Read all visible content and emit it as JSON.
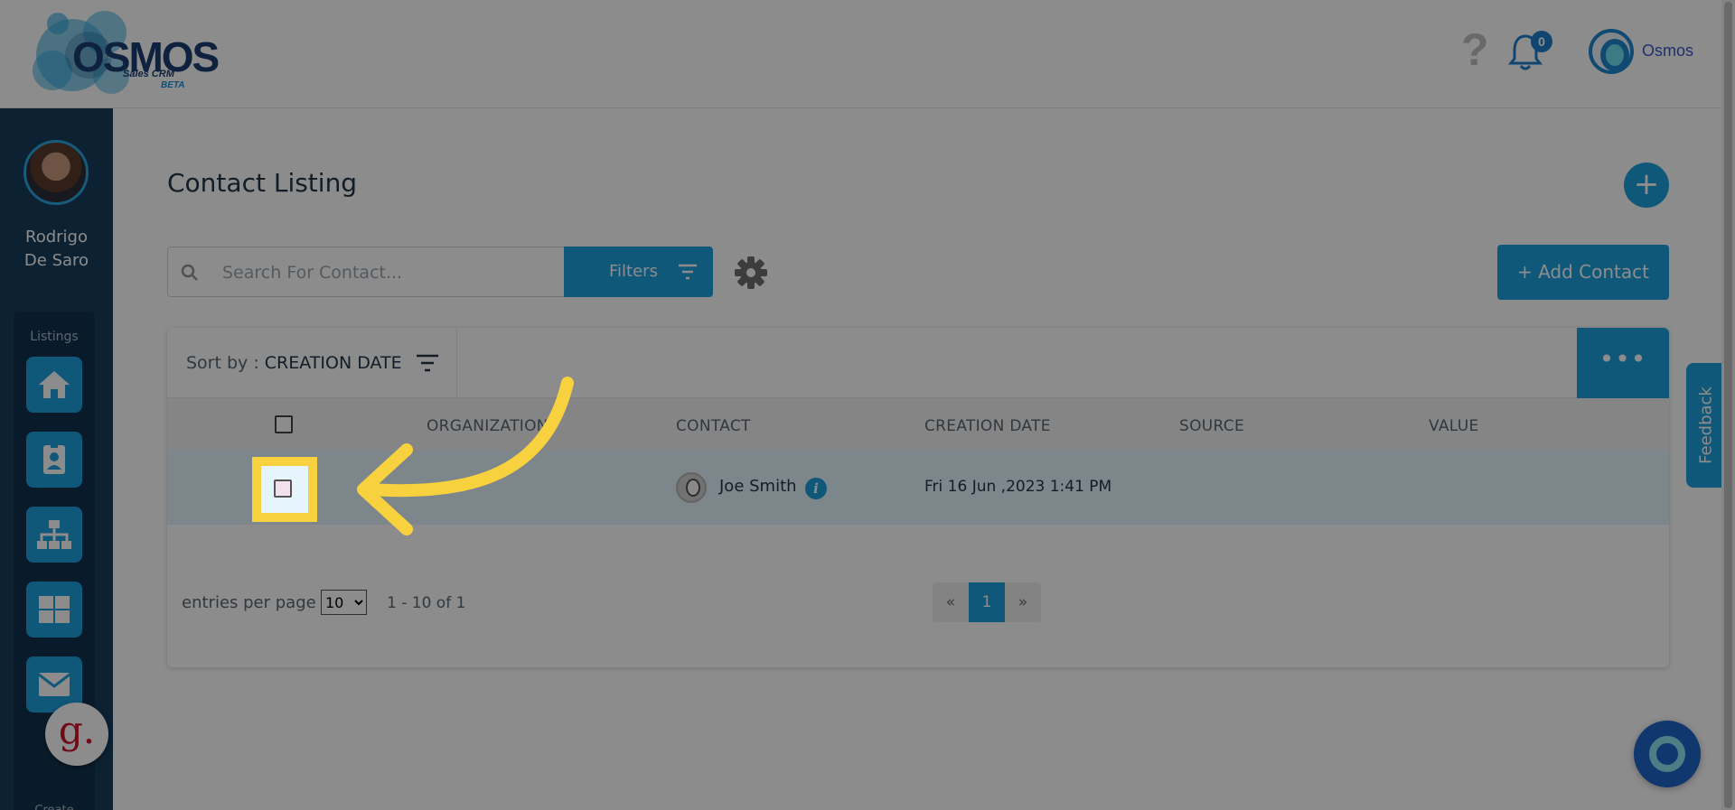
{
  "header": {
    "logo_text": "OSMOS",
    "logo_sub": "Sales CRM",
    "logo_beta": "BETA",
    "help_symbol": "?",
    "notification_count": "0",
    "user_name": "Osmos"
  },
  "sidebar": {
    "profile_name": "Rodrigo De Saro",
    "section_label": "Listings",
    "nav_items": [
      {
        "icon": "home-icon"
      },
      {
        "icon": "contact-card-icon"
      },
      {
        "icon": "organization-icon"
      },
      {
        "icon": "grid-icon"
      },
      {
        "icon": "mail-icon"
      }
    ],
    "create_label": "Create"
  },
  "main": {
    "page_title": "Contact Listing",
    "add_symbol": "+",
    "search_placeholder": "Search For Contact...",
    "filters_label": "Filters",
    "add_contact_label": "+ Add Contact",
    "sort_prefix": "Sort by : ",
    "sort_value": "CREATION DATE",
    "more_symbol": "•••",
    "columns": [
      "ORGANIZATION",
      "CONTACT",
      "CREATION DATE",
      "SOURCE",
      "VALUE"
    ],
    "rows": [
      {
        "organization": "",
        "contact": "Joe Smith",
        "creation_date": "Fri 16 Jun ,2023 1:41 PM",
        "source": "",
        "value": ""
      }
    ],
    "entries_label": "entries per page",
    "entries_value": "10",
    "range_text": "1 - 10 of 1",
    "pager": {
      "prev": "«",
      "current": "1",
      "next": "»"
    }
  },
  "feedback_label": "Feedback",
  "g_badge": "g.",
  "colors": {
    "accent": "#1ea0df",
    "sidebar": "#163c5b",
    "highlight": "#f7d23e"
  }
}
